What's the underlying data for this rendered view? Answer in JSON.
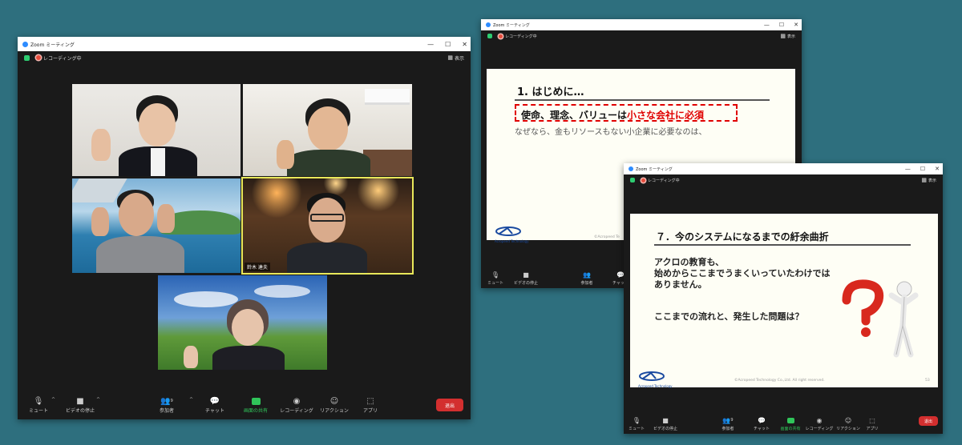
{
  "window_main": {
    "title": "Zoom ミーティング",
    "recording": "レコーディング中",
    "view": "表示",
    "participants": [
      {
        "name": ""
      },
      {
        "name": ""
      },
      {
        "name": ""
      },
      {
        "name": "鈴木 達夫"
      },
      {
        "name": ""
      }
    ]
  },
  "window_slide1": {
    "title": "Zoom ミーティング",
    "recording": "レコーディング中",
    "view": "表示",
    "slide": {
      "heading": "1. はじめに…",
      "box_text_plain": "使命、理念、バリューは",
      "box_text_red": "小さな会社に必須",
      "line2": "なぜなら、金もリソースもない小企業に必要なのは、",
      "logo_text": "Acropeed Technology",
      "copyright": "©Acropeed Te"
    }
  },
  "window_slide2": {
    "title": "Zoom ミーティング",
    "recording": "レコーディング中",
    "view": "表示",
    "slide": {
      "heading": "７．今のシステムになるまでの紆余曲折",
      "line1": "アクロの教育も、",
      "line2": "始めからここまでうまくいっていたわけでは",
      "line3": "ありません。",
      "line4": "ここまでの流れと、発生した問題は？",
      "logo_text": "Acropeed Technology",
      "copyright": "©Acropeed Technology Co.,Ltd. All right reserved.",
      "page": "53"
    }
  },
  "toolbar": {
    "mute": "ミュート",
    "video": "ビデオの停止",
    "participants": "参加者",
    "participants_count": "9",
    "chat": "チャット",
    "share": "画面の共有",
    "record": "レコーディング",
    "reactions": "リアクション",
    "apps": "アプリ",
    "end": "退出"
  },
  "colors": {
    "background": "#2e6f7e",
    "share_green": "#30c55a",
    "end_red": "#d32f2f",
    "slide_red": "#e00000"
  }
}
